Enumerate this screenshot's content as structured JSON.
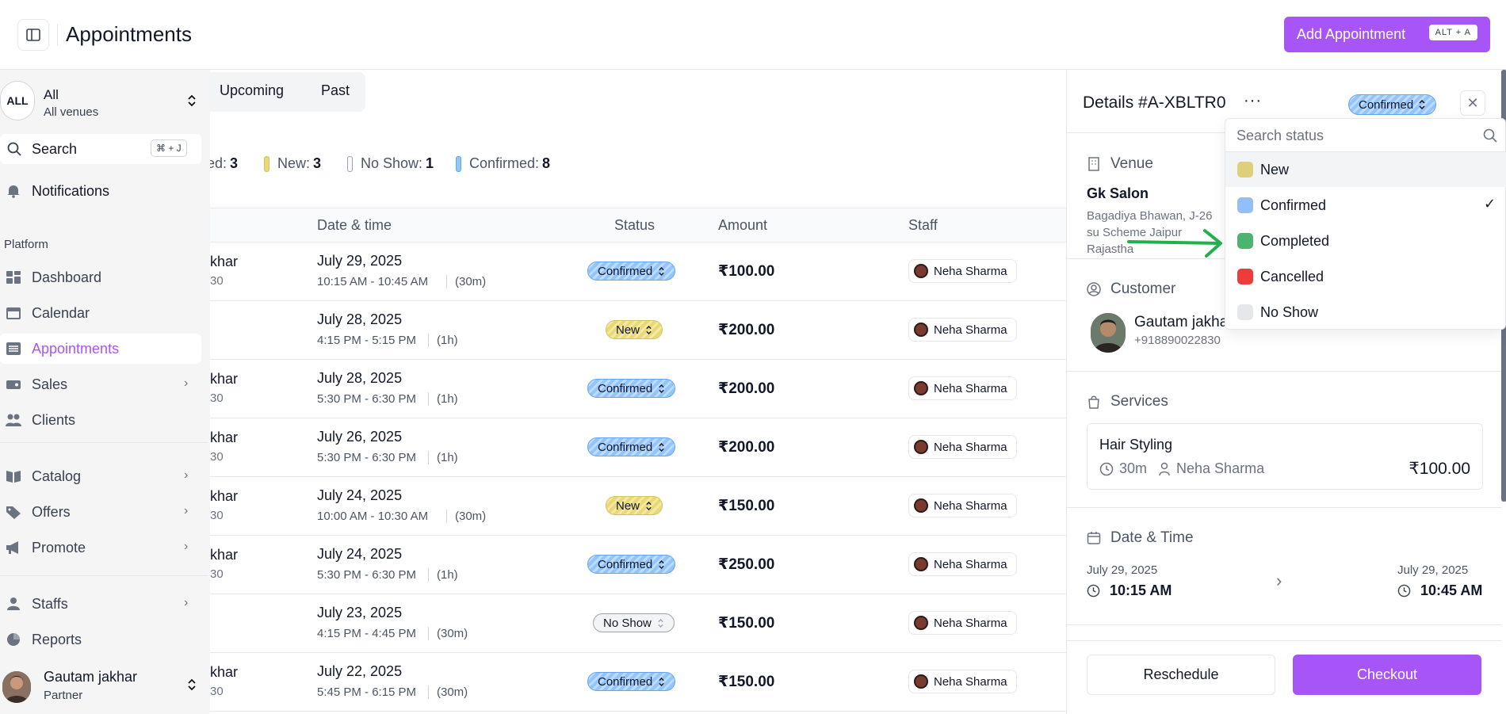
{
  "header": {
    "title": "Appointments",
    "add_button": "Add Appointment",
    "add_shortcut": "ALT + A"
  },
  "sidebar": {
    "venue": {
      "avatar": "ALL",
      "name": "All",
      "sub": "All venues"
    },
    "search": {
      "label": "Search",
      "shortcut": "⌘ + J"
    },
    "notifications": "Notifications",
    "section": "Platform",
    "items": [
      {
        "label": "Dashboard",
        "icon": "dashboard-icon"
      },
      {
        "label": "Calendar",
        "icon": "calendar-icon"
      },
      {
        "label": "Appointments",
        "icon": "list-icon",
        "active": true
      },
      {
        "label": "Sales",
        "icon": "wallet-icon"
      },
      {
        "label": "Clients",
        "icon": "users-icon"
      },
      {
        "label": "Catalog",
        "icon": "book-icon"
      },
      {
        "label": "Offers",
        "icon": "tag-icon"
      },
      {
        "label": "Promote",
        "icon": "megaphone-icon"
      },
      {
        "label": "Staffs",
        "icon": "user-icon"
      },
      {
        "label": "Reports",
        "icon": "pie-chart-icon"
      }
    ],
    "user": {
      "name": "Gautam jakhar",
      "role": "Partner"
    }
  },
  "tabs": {
    "upcoming": "Upcoming",
    "past": "Past"
  },
  "counts": [
    {
      "label": "ed:",
      "value": "3",
      "color": "#9ca3af",
      "show_bar": false
    },
    {
      "label": "New:",
      "value": "3",
      "color": "#e8d876",
      "show_bar": true
    },
    {
      "label": "No Show:",
      "value": "1",
      "color": "#e5e7eb",
      "show_bar": true
    },
    {
      "label": "Confirmed:",
      "value": "8",
      "color": "#93c5fd",
      "show_bar": true
    }
  ],
  "table": {
    "headers": {
      "date": "Date & time",
      "status": "Status",
      "amount": "Amount",
      "staff": "Staff"
    },
    "rows": [
      {
        "name": "khar",
        "name2": "30",
        "date": "July 29, 2025",
        "time": "10:15 AM - 10:45 AM",
        "duration": "(30m)",
        "status": "Confirmed",
        "amount": "₹100.00",
        "staff": "Neha Sharma"
      },
      {
        "name": "",
        "name2": "",
        "date": "July 28, 2025",
        "time": "4:15 PM - 5:15 PM",
        "duration": "(1h)",
        "status": "New",
        "amount": "₹200.00",
        "staff": "Neha Sharma"
      },
      {
        "name": "khar",
        "name2": "30",
        "date": "July 28, 2025",
        "time": "5:30 PM - 6:30 PM",
        "duration": "(1h)",
        "status": "Confirmed",
        "amount": "₹200.00",
        "staff": "Neha Sharma"
      },
      {
        "name": "khar",
        "name2": "30",
        "date": "July 26, 2025",
        "time": "5:30 PM - 6:30 PM",
        "duration": "(1h)",
        "status": "Confirmed",
        "amount": "₹200.00",
        "staff": "Neha Sharma"
      },
      {
        "name": "khar",
        "name2": "30",
        "date": "July 24, 2025",
        "time": "10:00 AM - 10:30 AM",
        "duration": "(30m)",
        "status": "New",
        "amount": "₹150.00",
        "staff": "Neha Sharma"
      },
      {
        "name": "khar",
        "name2": "30",
        "date": "July 24, 2025",
        "time": "5:30 PM - 6:30 PM",
        "duration": "(1h)",
        "status": "Confirmed",
        "amount": "₹250.00",
        "staff": "Neha Sharma"
      },
      {
        "name": "",
        "name2": "",
        "date": "July 23, 2025",
        "time": "4:15 PM - 4:45 PM",
        "duration": "(30m)",
        "status": "No Show",
        "amount": "₹150.00",
        "staff": "Neha Sharma"
      },
      {
        "name": "khar",
        "name2": "30",
        "date": "July 22, 2025",
        "time": "5:45 PM - 6:15 PM",
        "duration": "(30m)",
        "status": "Confirmed",
        "amount": "₹150.00",
        "staff": "Neha Sharma"
      }
    ]
  },
  "details": {
    "title": "Details #A-XBLTR0",
    "status": "Confirmed",
    "venue_label": "Venue",
    "venue_name": "Gk Salon",
    "venue_addr": "Bagadiya Bhawan, J-26 su Scheme Jaipur Rajastha",
    "customer_label": "Customer",
    "customer_name": "Gautam jakha",
    "customer_phone": "+918890022830",
    "services_label": "Services",
    "service": {
      "name": "Hair Styling",
      "duration": "30m",
      "staff": "Neha Sharma",
      "price": "₹100.00"
    },
    "datetime_label": "Date & Time",
    "start": {
      "date": "July 29, 2025",
      "time": "10:15 AM"
    },
    "end": {
      "date": "July 29, 2025",
      "time": "10:45 AM"
    },
    "reschedule": "Reschedule",
    "checkout": "Checkout"
  },
  "status_dropdown": {
    "placeholder": "Search status",
    "options": [
      {
        "label": "New",
        "color": "#ddd07a",
        "highlighted": true,
        "selected": false
      },
      {
        "label": "Confirmed",
        "color": "#93bff9",
        "highlighted": false,
        "selected": true
      },
      {
        "label": "Completed",
        "color": "#4bb46e",
        "highlighted": false,
        "selected": false
      },
      {
        "label": "Cancelled",
        "color": "#ef3b3b",
        "highlighted": false,
        "selected": false
      },
      {
        "label": "No Show",
        "color": "#e5e7eb",
        "highlighted": false,
        "selected": false
      }
    ]
  },
  "colors": {
    "accent": "#a855f7",
    "annotation_arrow": "#22b04c"
  }
}
